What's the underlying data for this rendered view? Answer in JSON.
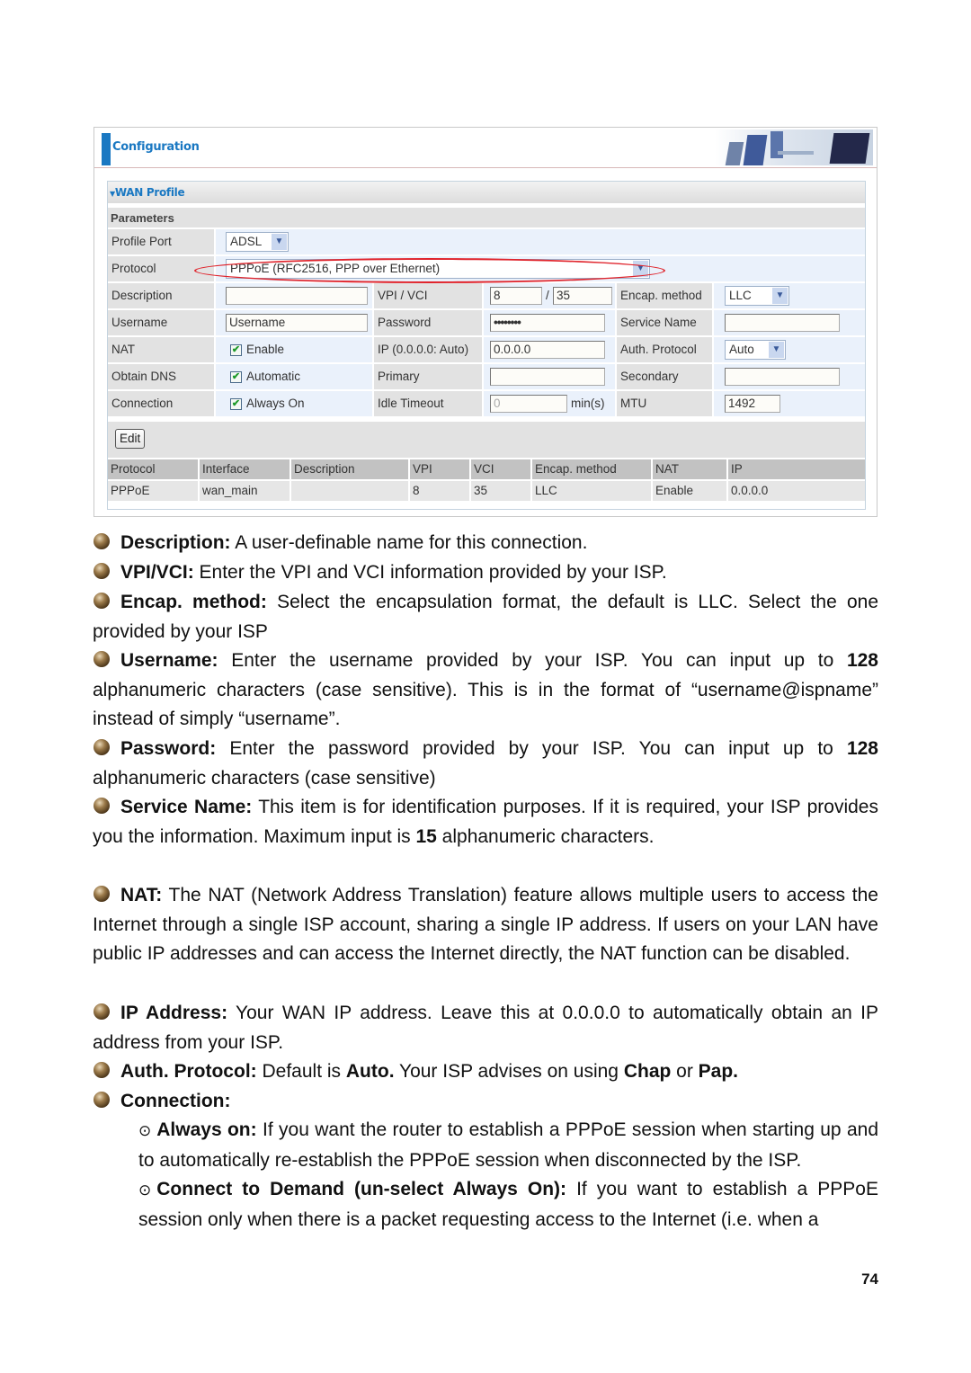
{
  "screenshot": {
    "header_title": "Configuration",
    "section_title": "WAN Profile",
    "parameters_label": "Parameters",
    "fields": {
      "profile_port": {
        "label": "Profile Port",
        "value": "ADSL"
      },
      "protocol": {
        "label": "Protocol",
        "value": "PPPoE (RFC2516, PPP over Ethernet)"
      },
      "description": {
        "label": "Description",
        "value": ""
      },
      "vpi_vci": {
        "label": "VPI / VCI",
        "vpi": "8",
        "separator": "/",
        "vci": "35"
      },
      "encap_method": {
        "label": "Encap. method",
        "value": "LLC"
      },
      "username": {
        "label": "Username",
        "value": "Username"
      },
      "password": {
        "label": "Password",
        "value": "••••••••"
      },
      "service_name": {
        "label": "Service Name",
        "value": ""
      },
      "nat": {
        "label": "NAT",
        "checkbox_label": "Enable",
        "checked": true
      },
      "ip": {
        "label": "IP (0.0.0.0: Auto)",
        "value": "0.0.0.0"
      },
      "auth_protocol": {
        "label": "Auth. Protocol",
        "value": "Auto"
      },
      "obtain_dns": {
        "label": "Obtain DNS",
        "checkbox_label": "Automatic",
        "checked": true
      },
      "primary": {
        "label": "Primary",
        "value": ""
      },
      "secondary": {
        "label": "Secondary",
        "value": ""
      },
      "connection": {
        "label": "Connection",
        "checkbox_label": "Always On",
        "checked": true
      },
      "idle_timeout": {
        "label": "Idle Timeout",
        "value": "0",
        "unit": "min(s)"
      },
      "mtu": {
        "label": "MTU",
        "value": "1492"
      }
    },
    "edit_button": "Edit",
    "table": {
      "headers": [
        "Protocol",
        "Interface",
        "Description",
        "VPI",
        "VCI",
        "Encap. method",
        "NAT",
        "IP"
      ],
      "rows": [
        [
          "PPPoE",
          "wan_main",
          "",
          "8",
          "35",
          "LLC",
          "Enable",
          "0.0.0.0"
        ]
      ]
    },
    "highlight_color": "#e0232b",
    "accent_color": "#1a78c2"
  },
  "body": {
    "description": {
      "term": "Description:",
      "text": " A user-definable name for this connection."
    },
    "vpi_vci": {
      "term": "VPI/VCI:",
      "text": " Enter the VPI and VCI information provided by your ISP."
    },
    "encap": {
      "term": "Encap. method:",
      "text": " Select the encapsulation format, the default is LLC. Select the one provided by your ISP"
    },
    "username": {
      "term": "Username:",
      "text1": " Enter the username provided by your ISP. You can input up to ",
      "num": "128",
      "text2": " alphanumeric characters (case sensitive). This is in the format of “username@ispname” instead of simply “username”."
    },
    "password": {
      "term": "Password:",
      "text1": " Enter the password provided by your ISP. You can input up to ",
      "num": "128",
      "text2": " alphanumeric characters (case sensitive)"
    },
    "service_name": {
      "term": "Service Name:",
      "text1": " This item is for identification purposes. If it is required, your ISP provides you the information. Maximum input is ",
      "num": "15",
      "text2": " alphanumeric characters."
    },
    "nat": {
      "term": "NAT:",
      "text": " The NAT (Network Address Translation) feature allows multiple users to access the Internet through a single ISP account, sharing a single IP address. If users on your LAN have public IP addresses and can access the Internet directly, the NAT function can be disabled."
    },
    "ip_address": {
      "term": "IP Address:",
      "text": " Your WAN IP address. Leave this at 0.0.0.0 to automatically obtain an IP address from your ISP."
    },
    "auth": {
      "term": "Auth. Protocol:",
      "t1": " Default is ",
      "b1": "Auto.",
      "t2": " Your ISP advises on using ",
      "b2": "Chap",
      "t3": " or ",
      "b3": "Pap."
    },
    "connection": {
      "term": "Connection:"
    },
    "always_on": {
      "symbol": "⊙",
      "term": "Always on:",
      "text": " If you want the router to establish a PPPoE session when starting up and to automatically re-establish the PPPoE session when disconnected by the ISP."
    },
    "demand": {
      "symbol": "⊙",
      "term": "Connect to Demand (un-select Always On):",
      "text": " If you want to establish a PPPoE session only when there is a packet requesting access to the Internet (i.e. when a"
    }
  },
  "page_number": "74"
}
